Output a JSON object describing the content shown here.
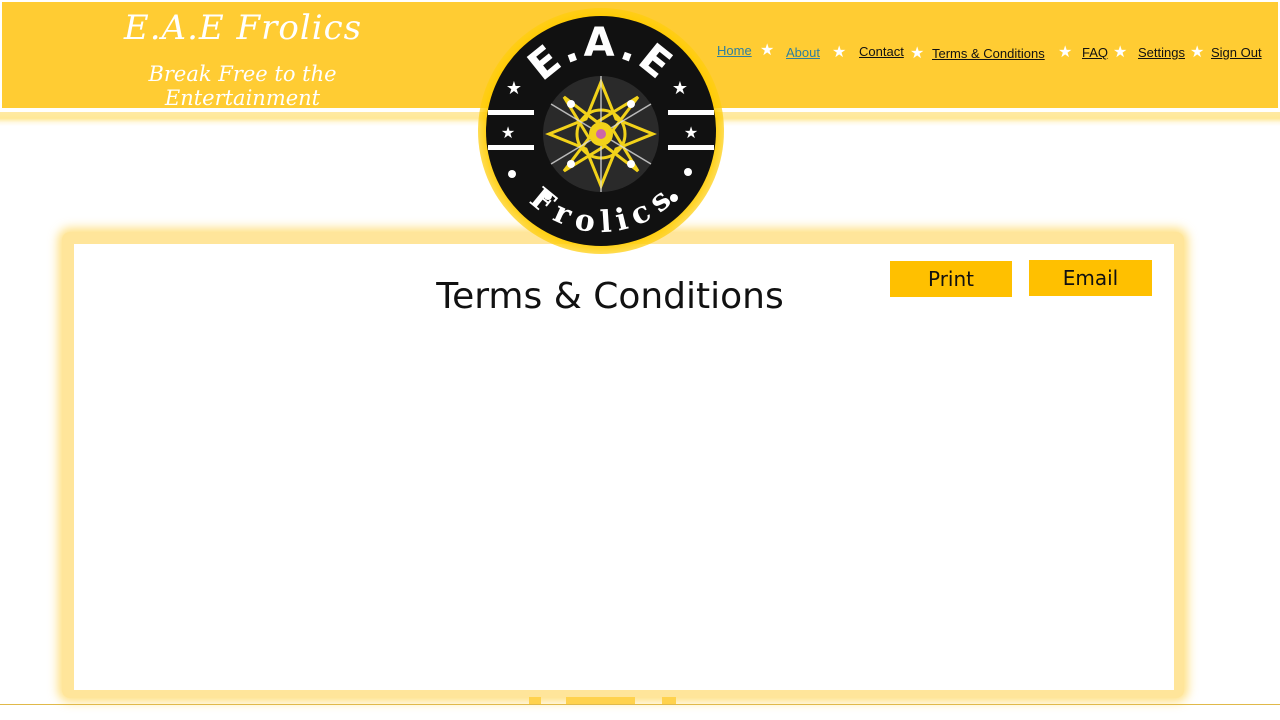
{
  "brand": {
    "title": "E.A.E Frolics",
    "tagline": "Break Free to the Entertainment"
  },
  "nav": {
    "items": [
      {
        "label": "Home"
      },
      {
        "label": "About"
      },
      {
        "label": "Contact"
      },
      {
        "label": "Terms & Conditions"
      },
      {
        "label": "FAQ"
      },
      {
        "label": "Settings"
      },
      {
        "label": "Sign Out"
      }
    ]
  },
  "logo": {
    "top_text": "E.A.E",
    "bottom_text": "Frolics"
  },
  "main": {
    "title": "Terms & Conditions",
    "print_label": "Print",
    "email_label": "Email"
  },
  "colors": {
    "brand_yellow": "#ffcc33",
    "button_yellow": "#ffc000",
    "logo_black": "#111111"
  }
}
